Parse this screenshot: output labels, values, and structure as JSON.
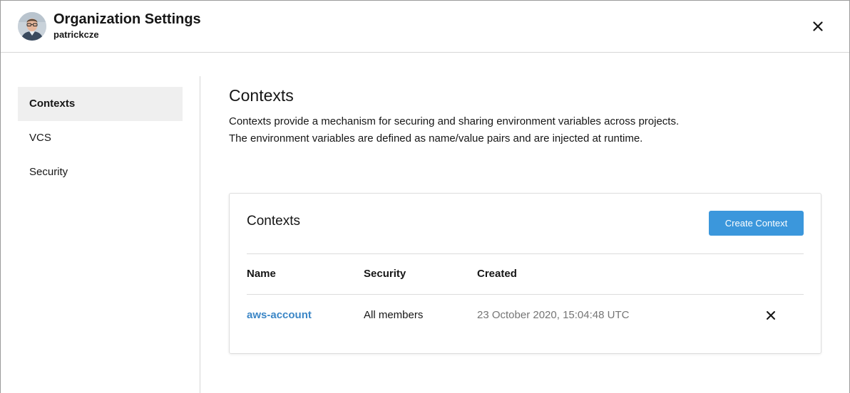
{
  "header": {
    "title": "Organization Settings",
    "username": "patrickcze",
    "avatar_icon": "user-avatar",
    "close_icon": "close-icon"
  },
  "sidebar": {
    "items": [
      {
        "label": "Contexts",
        "active": true
      },
      {
        "label": "VCS",
        "active": false
      },
      {
        "label": "Security",
        "active": false
      }
    ]
  },
  "main": {
    "title": "Contexts",
    "description": "Contexts provide a mechanism for securing and sharing environment variables across projects. The environment variables are defined as name/value pairs and are injected at runtime.",
    "card": {
      "title": "Contexts",
      "create_button": "Create Context",
      "columns": [
        "Name",
        "Security",
        "Created"
      ],
      "rows": [
        {
          "name": "aws-account",
          "security": "All members",
          "created": "23 October 2020, 15:04:48 UTC",
          "action_icon": "close-icon"
        }
      ]
    }
  },
  "colors": {
    "accent": "#3b97dc",
    "link": "#3b86c6",
    "active_bg": "#efefef",
    "divider": "#d6d6d6",
    "muted_text": "#757575"
  }
}
